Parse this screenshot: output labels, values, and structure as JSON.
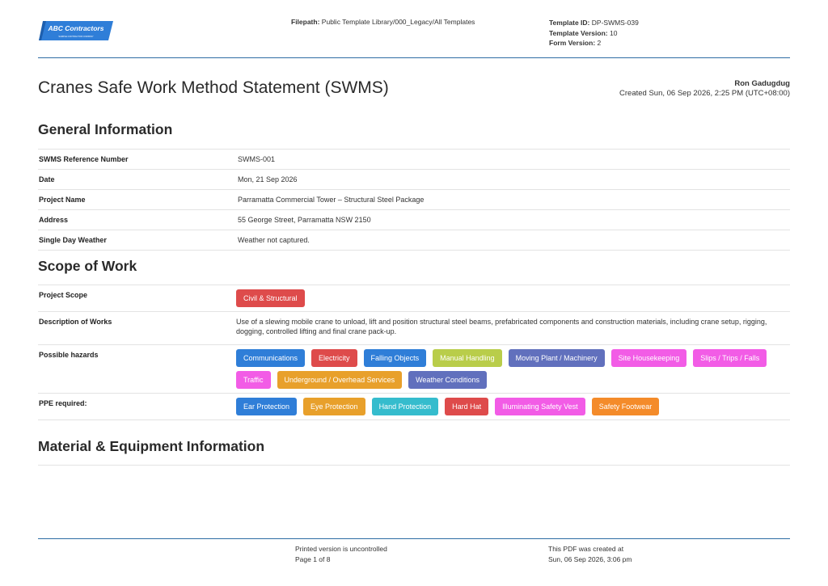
{
  "header": {
    "logo_text": "ABC Contractors",
    "logo_subtext": "SAMPLE CONTRACTOR COMPANY",
    "filepath_label": "Filepath:",
    "filepath_value": "Public Template Library/000_Legacy/All Templates",
    "template_id_label": "Template ID:",
    "template_id_value": "DP-SWMS-039",
    "template_version_label": "Template Version:",
    "template_version_value": "10",
    "form_version_label": "Form Version:",
    "form_version_value": "2"
  },
  "document": {
    "title": "Cranes Safe Work Method Statement (SWMS)",
    "author": "Ron Gadugdug",
    "created": "Created Sun, 06 Sep 2026, 2:25 PM (UTC+08:00)"
  },
  "general": {
    "heading": "General Information",
    "rows": [
      {
        "label": "SWMS Reference Number",
        "value": "SWMS-001"
      },
      {
        "label": "Date",
        "value": "Mon, 21 Sep 2026"
      },
      {
        "label": "Project Name",
        "value": "Parramatta Commercial Tower – Structural Steel Package"
      },
      {
        "label": "Address",
        "value": "55 George Street, Parramatta NSW 2150"
      },
      {
        "label": "Single Day Weather",
        "value": "Weather not captured."
      }
    ]
  },
  "scope": {
    "heading": "Scope of Work",
    "project_scope_label": "Project Scope",
    "project_scope_tags": [
      {
        "text": "Civil & Structural",
        "color": "#de4b4b"
      }
    ],
    "description_label": "Description of Works",
    "description_value": "Use of a slewing mobile crane to unload, lift and position structural steel beams, prefabricated components and construction materials, including crane setup, rigging, dogging, controlled lifting and final crane pack-up.",
    "hazards_label": "Possible hazards",
    "hazards": [
      {
        "text": "Communications",
        "color": "#2f7ed8"
      },
      {
        "text": "Electricity",
        "color": "#de4b4b"
      },
      {
        "text": "Falling Objects",
        "color": "#2f7ed8"
      },
      {
        "text": "Manual Handling",
        "color": "#b9cd4a"
      },
      {
        "text": "Moving Plant / Machinery",
        "color": "#6170bd"
      },
      {
        "text": "Site Housekeeping",
        "color": "#f25ce6"
      },
      {
        "text": "Slips / Trips / Falls",
        "color": "#f25ce6"
      },
      {
        "text": "Traffic",
        "color": "#f25ce6"
      },
      {
        "text": "Underground / Overhead Services",
        "color": "#e8a02b"
      },
      {
        "text": "Weather Conditions",
        "color": "#6170bd"
      }
    ],
    "ppe_label": "PPE required:",
    "ppe": [
      {
        "text": "Ear Protection",
        "color": "#2f7ed8"
      },
      {
        "text": "Eye Protection",
        "color": "#e8a02b"
      },
      {
        "text": "Hand Protection",
        "color": "#35bccd"
      },
      {
        "text": "Hard Hat",
        "color": "#de4b4b"
      },
      {
        "text": "Illuminating Safety Vest",
        "color": "#f25ce6"
      },
      {
        "text": "Safety Footwear",
        "color": "#f48b2a"
      }
    ]
  },
  "material": {
    "heading": "Material & Equipment Information"
  },
  "footer": {
    "uncontrolled": "Printed version is uncontrolled",
    "page": "Page 1 of 8",
    "pdf_created_label": "This PDF was created at",
    "pdf_created_value": "Sun, 06 Sep 2026, 3:06 pm"
  }
}
